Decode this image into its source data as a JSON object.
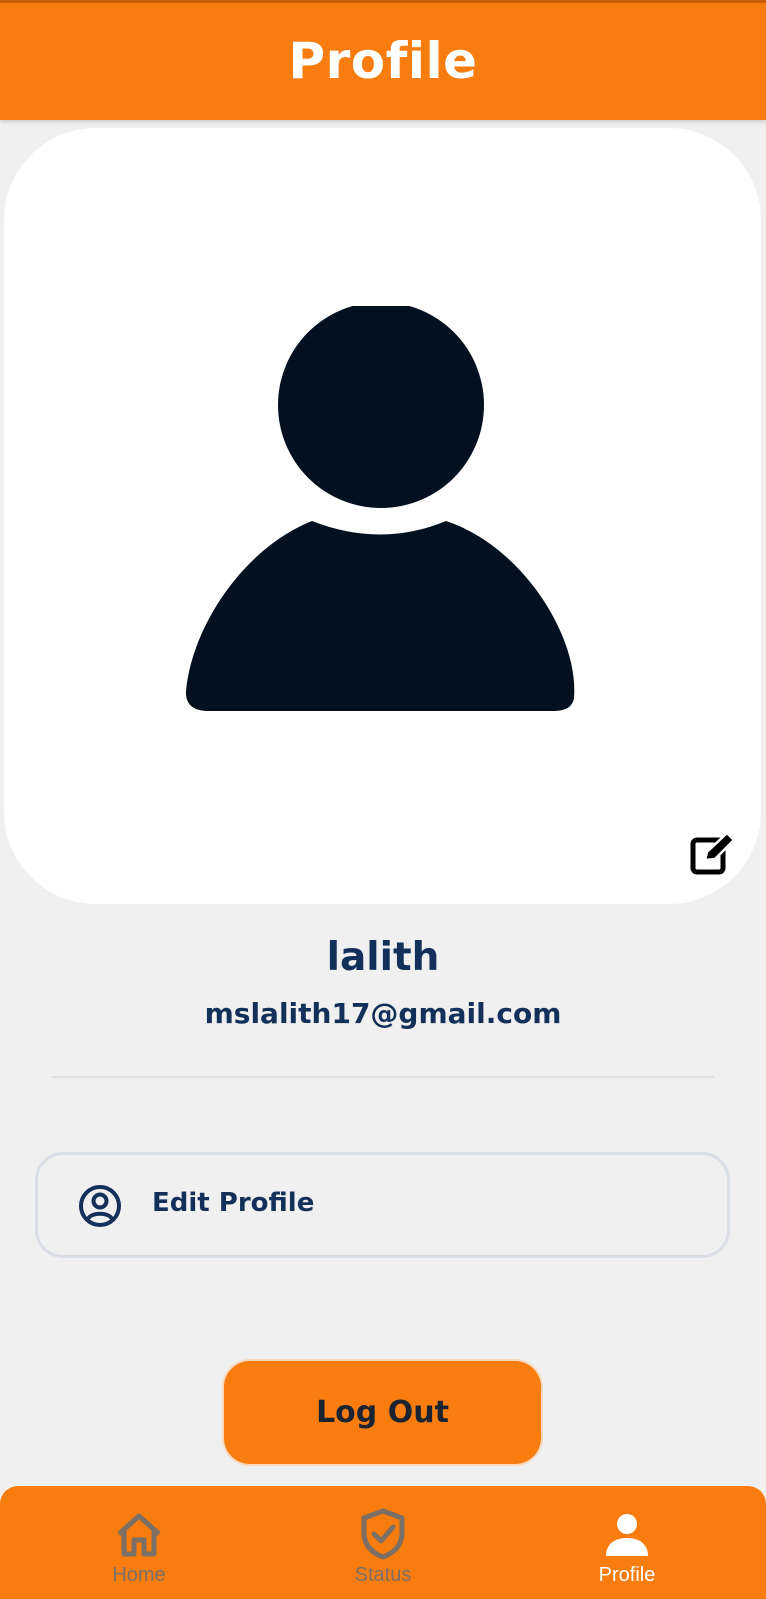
{
  "header": {
    "title": "Profile"
  },
  "profile": {
    "name": "lalith",
    "email": "mslalith17@gmail.com",
    "avatar_icon": "person-silhouette-icon",
    "edit_photo_icon": "edit-icon"
  },
  "menu": {
    "edit_profile_label": "Edit Profile",
    "edit_profile_icon": "user-circle-icon"
  },
  "logout": {
    "label": "Log Out"
  },
  "nav": {
    "items": [
      {
        "label": "Home",
        "icon": "home-icon",
        "active": false
      },
      {
        "label": "Status",
        "icon": "shield-check-icon",
        "active": false
      },
      {
        "label": "Profile",
        "icon": "person-icon",
        "active": true
      }
    ]
  },
  "colors": {
    "accent": "#f87c0e",
    "text_primary": "#13305a",
    "background": "#f0f0f0",
    "nav_inactive": "#7b6f66",
    "nav_active": "#ffffff"
  }
}
